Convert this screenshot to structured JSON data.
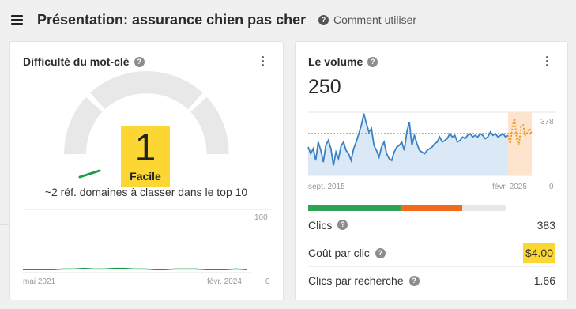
{
  "header": {
    "title": "Présentation: assurance chien pas cher",
    "help_label": "Comment utiliser"
  },
  "kd_card": {
    "title": "Difficulté du mot-clé",
    "score": "1",
    "score_label": "Facile",
    "description": "~2 réf. domaines à classer dans le top 10",
    "history": {
      "y_max_label": "100",
      "y_min_label": "0",
      "x_start_label": "mai 2021",
      "x_end_label": "févr. 2024",
      "values": [
        1,
        1,
        1,
        1,
        2,
        2,
        3,
        2,
        2,
        3,
        3,
        2,
        2,
        1,
        1,
        2,
        2,
        2,
        1,
        1,
        1,
        2,
        1
      ]
    },
    "colors": {
      "score": "#fcd734",
      "trend": "#1a9a4a"
    }
  },
  "volume_card": {
    "title": "Le volume",
    "volume": "250",
    "chart": {
      "y_max_label": "378",
      "y_min_label": "0",
      "x_start_label": "sept. 2015",
      "x_end_label": "févr. 2025",
      "ylim": [
        0,
        378
      ],
      "reference_value": 250,
      "history": [
        170,
        130,
        160,
        90,
        200,
        150,
        80,
        180,
        210,
        160,
        60,
        140,
        100,
        175,
        200,
        150,
        130,
        90,
        160,
        200,
        250,
        300,
        370,
        310,
        260,
        280,
        180,
        150,
        110,
        170,
        200,
        130,
        100,
        90,
        140,
        170,
        180,
        200,
        150,
        260,
        320,
        180,
        240,
        190,
        150,
        140,
        130,
        150,
        160,
        170,
        190,
        200,
        230,
        200,
        210,
        220,
        250,
        230,
        240,
        200,
        210,
        230,
        220,
        240,
        250,
        230,
        240,
        230,
        250,
        240,
        220,
        230,
        260,
        240,
        250,
        230,
        240,
        250,
        230,
        240
      ],
      "forecast": [
        240,
        190,
        290,
        340,
        220,
        180,
        290,
        300,
        240,
        260,
        280,
        250
      ]
    },
    "distribution": [
      {
        "fraction": 0.47,
        "color": "#2ea356"
      },
      {
        "fraction": 0.31,
        "color": "#f26b1d"
      },
      {
        "fraction": 0.22,
        "color": "#e8e8e8"
      }
    ],
    "metrics": [
      {
        "label": "Clics",
        "value": "383"
      },
      {
        "label": "Coût par clic",
        "value": "$4.00"
      },
      {
        "label": "Clics par recherche",
        "value": "1.66"
      }
    ],
    "colors": {
      "history": "#3b82c4",
      "forecast": "#f39a2b"
    }
  }
}
